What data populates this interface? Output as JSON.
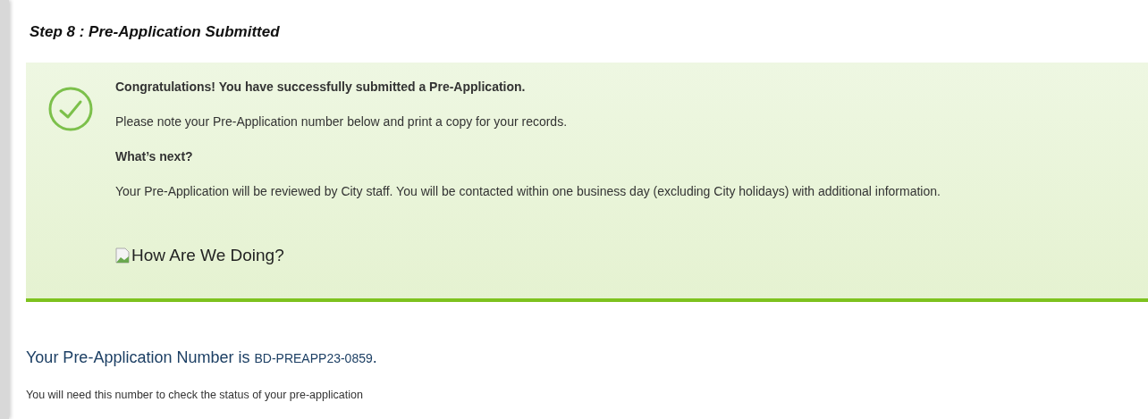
{
  "step_title": "Step 8 : Pre-Application Submitted",
  "success_panel": {
    "lines": [
      {
        "text": "Congratulations! You have successfully submitted a Pre-Application.",
        "bold": true
      },
      {
        "text": "Please note your Pre-Application number below and print a copy for your records.",
        "bold": false
      },
      {
        "text": "What’s next?",
        "bold": true
      },
      {
        "text": "Your Pre-Application will be reviewed by City staff. You will be contacted within one business day (excluding City holidays) with additional information.",
        "bold": false
      }
    ],
    "survey_image_alt": "How Are We Doing?"
  },
  "number_heading": {
    "text": "Your Pre-Application Number is",
    "number": "BD-PREAPP23-0859",
    "end": "."
  },
  "note": "You will need this number to check the status of your pre-application"
}
